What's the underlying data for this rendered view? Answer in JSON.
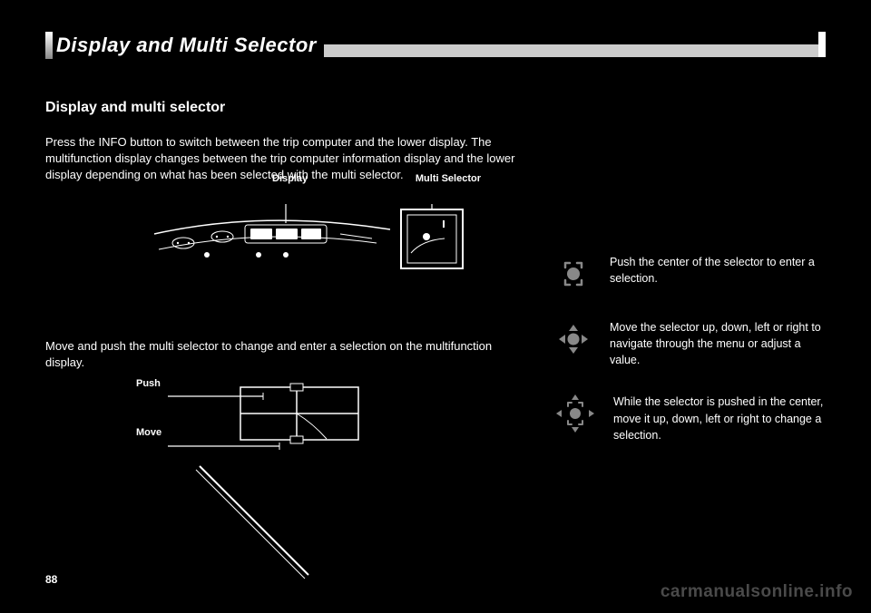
{
  "header": {
    "title": "Display and Multi Selector"
  },
  "left": {
    "subtitle": "Display and multi selector",
    "para1": "Press the INFO button to switch between the trip computer and the lower display. The multifunction display changes between the trip computer information display and the lower display depending on what has been selected with the multi selector.",
    "dash": {
      "label_display": "Display",
      "label_multi": "Multi Selector"
    },
    "para2": "Move and push the multi selector to change and enter a selection on the multifunction display.",
    "multi": {
      "label_push": "Push",
      "label_move": "Move"
    }
  },
  "right": {
    "enter": "Push the center of the selector to enter a selection.",
    "move": "Move the selector up, down, left or right to navigate through the menu or adjust a value.",
    "combo": "While the selector is pushed in the center, move it up, down, left or right to change a selection."
  },
  "page_num": "88",
  "watermark": "carmanualsonline.info"
}
